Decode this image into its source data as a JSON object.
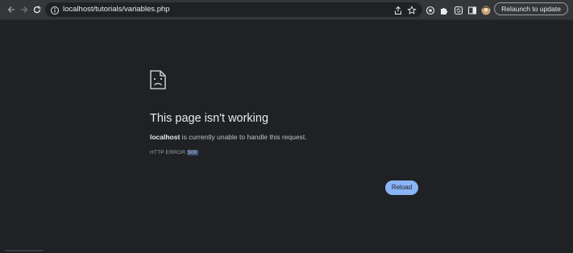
{
  "browser": {
    "url": "localhost/tutorials/variables.php",
    "relaunch_label": "Relaunch to update"
  },
  "error_page": {
    "title": "This page isn't working",
    "host": "localhost",
    "message": " is currently unable to handle this request.",
    "code_prefix": "HTTP ERROR ",
    "code_number": "500",
    "reload_label": "Reload"
  },
  "icons": {
    "back": "back-arrow-icon",
    "forward": "forward-arrow-icon",
    "reload": "reload-icon",
    "site_info": "site-info-icon",
    "share": "share-icon",
    "bookmark": "star-icon",
    "extensions": [
      "extension-icon",
      "puzzle-icon",
      "sync-icon",
      "sidebar-icon",
      "avatar-icon"
    ],
    "error": "sad-document-icon"
  },
  "colors": {
    "background": "#202124",
    "toolbar": "#35363a",
    "accent": "#8ab4f8"
  }
}
